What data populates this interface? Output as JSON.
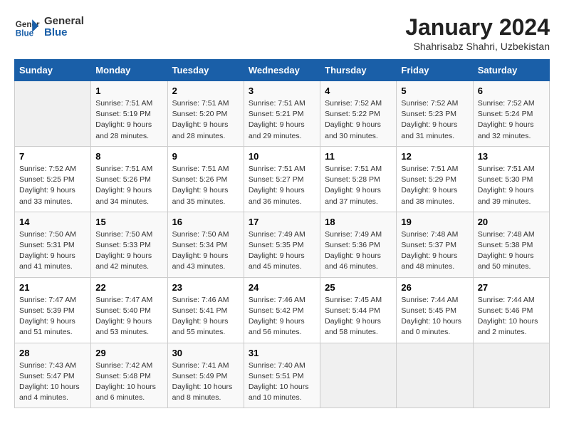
{
  "logo": {
    "name_line1": "General",
    "name_line2": "Blue"
  },
  "title": "January 2024",
  "location": "Shahrisabz Shahri, Uzbekistan",
  "days_of_week": [
    "Sunday",
    "Monday",
    "Tuesday",
    "Wednesday",
    "Thursday",
    "Friday",
    "Saturday"
  ],
  "weeks": [
    [
      {
        "day": "",
        "info": ""
      },
      {
        "day": "1",
        "info": "Sunrise: 7:51 AM\nSunset: 5:19 PM\nDaylight: 9 hours\nand 28 minutes."
      },
      {
        "day": "2",
        "info": "Sunrise: 7:51 AM\nSunset: 5:20 PM\nDaylight: 9 hours\nand 28 minutes."
      },
      {
        "day": "3",
        "info": "Sunrise: 7:51 AM\nSunset: 5:21 PM\nDaylight: 9 hours\nand 29 minutes."
      },
      {
        "day": "4",
        "info": "Sunrise: 7:52 AM\nSunset: 5:22 PM\nDaylight: 9 hours\nand 30 minutes."
      },
      {
        "day": "5",
        "info": "Sunrise: 7:52 AM\nSunset: 5:23 PM\nDaylight: 9 hours\nand 31 minutes."
      },
      {
        "day": "6",
        "info": "Sunrise: 7:52 AM\nSunset: 5:24 PM\nDaylight: 9 hours\nand 32 minutes."
      }
    ],
    [
      {
        "day": "7",
        "info": "Sunrise: 7:52 AM\nSunset: 5:25 PM\nDaylight: 9 hours\nand 33 minutes."
      },
      {
        "day": "8",
        "info": "Sunrise: 7:51 AM\nSunset: 5:26 PM\nDaylight: 9 hours\nand 34 minutes."
      },
      {
        "day": "9",
        "info": "Sunrise: 7:51 AM\nSunset: 5:26 PM\nDaylight: 9 hours\nand 35 minutes."
      },
      {
        "day": "10",
        "info": "Sunrise: 7:51 AM\nSunset: 5:27 PM\nDaylight: 9 hours\nand 36 minutes."
      },
      {
        "day": "11",
        "info": "Sunrise: 7:51 AM\nSunset: 5:28 PM\nDaylight: 9 hours\nand 37 minutes."
      },
      {
        "day": "12",
        "info": "Sunrise: 7:51 AM\nSunset: 5:29 PM\nDaylight: 9 hours\nand 38 minutes."
      },
      {
        "day": "13",
        "info": "Sunrise: 7:51 AM\nSunset: 5:30 PM\nDaylight: 9 hours\nand 39 minutes."
      }
    ],
    [
      {
        "day": "14",
        "info": "Sunrise: 7:50 AM\nSunset: 5:31 PM\nDaylight: 9 hours\nand 41 minutes."
      },
      {
        "day": "15",
        "info": "Sunrise: 7:50 AM\nSunset: 5:33 PM\nDaylight: 9 hours\nand 42 minutes."
      },
      {
        "day": "16",
        "info": "Sunrise: 7:50 AM\nSunset: 5:34 PM\nDaylight: 9 hours\nand 43 minutes."
      },
      {
        "day": "17",
        "info": "Sunrise: 7:49 AM\nSunset: 5:35 PM\nDaylight: 9 hours\nand 45 minutes."
      },
      {
        "day": "18",
        "info": "Sunrise: 7:49 AM\nSunset: 5:36 PM\nDaylight: 9 hours\nand 46 minutes."
      },
      {
        "day": "19",
        "info": "Sunrise: 7:48 AM\nSunset: 5:37 PM\nDaylight: 9 hours\nand 48 minutes."
      },
      {
        "day": "20",
        "info": "Sunrise: 7:48 AM\nSunset: 5:38 PM\nDaylight: 9 hours\nand 50 minutes."
      }
    ],
    [
      {
        "day": "21",
        "info": "Sunrise: 7:47 AM\nSunset: 5:39 PM\nDaylight: 9 hours\nand 51 minutes."
      },
      {
        "day": "22",
        "info": "Sunrise: 7:47 AM\nSunset: 5:40 PM\nDaylight: 9 hours\nand 53 minutes."
      },
      {
        "day": "23",
        "info": "Sunrise: 7:46 AM\nSunset: 5:41 PM\nDaylight: 9 hours\nand 55 minutes."
      },
      {
        "day": "24",
        "info": "Sunrise: 7:46 AM\nSunset: 5:42 PM\nDaylight: 9 hours\nand 56 minutes."
      },
      {
        "day": "25",
        "info": "Sunrise: 7:45 AM\nSunset: 5:44 PM\nDaylight: 9 hours\nand 58 minutes."
      },
      {
        "day": "26",
        "info": "Sunrise: 7:44 AM\nSunset: 5:45 PM\nDaylight: 10 hours\nand 0 minutes."
      },
      {
        "day": "27",
        "info": "Sunrise: 7:44 AM\nSunset: 5:46 PM\nDaylight: 10 hours\nand 2 minutes."
      }
    ],
    [
      {
        "day": "28",
        "info": "Sunrise: 7:43 AM\nSunset: 5:47 PM\nDaylight: 10 hours\nand 4 minutes."
      },
      {
        "day": "29",
        "info": "Sunrise: 7:42 AM\nSunset: 5:48 PM\nDaylight: 10 hours\nand 6 minutes."
      },
      {
        "day": "30",
        "info": "Sunrise: 7:41 AM\nSunset: 5:49 PM\nDaylight: 10 hours\nand 8 minutes."
      },
      {
        "day": "31",
        "info": "Sunrise: 7:40 AM\nSunset: 5:51 PM\nDaylight: 10 hours\nand 10 minutes."
      },
      {
        "day": "",
        "info": ""
      },
      {
        "day": "",
        "info": ""
      },
      {
        "day": "",
        "info": ""
      }
    ]
  ]
}
